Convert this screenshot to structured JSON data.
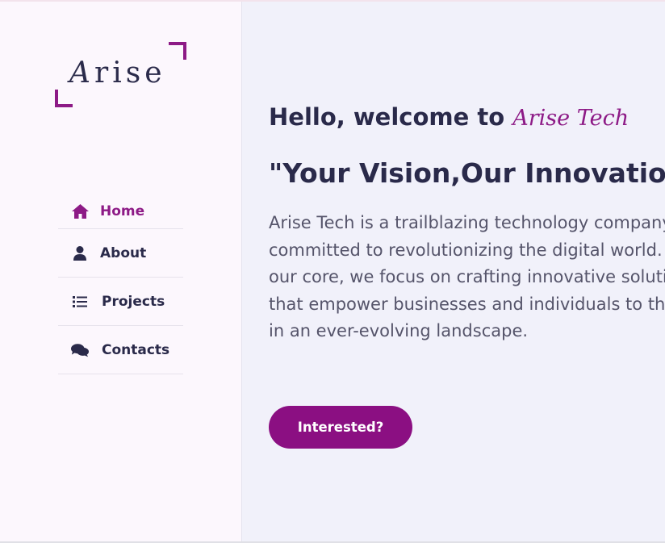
{
  "colors": {
    "accent": "#8d1a86",
    "button": "#8b0f82",
    "text_dark": "#2a2a4a",
    "text_body": "#55546a",
    "sidebar_bg": "#fcf7fd",
    "main_bg": "#f1f1fa"
  },
  "logo": {
    "first_letter": "A",
    "rest": "rise"
  },
  "nav": {
    "items": [
      {
        "label": "Home",
        "icon": "home-icon",
        "active": true
      },
      {
        "label": "About",
        "icon": "user-icon",
        "active": false
      },
      {
        "label": "Projects",
        "icon": "list-icon",
        "active": false
      },
      {
        "label": "Contacts",
        "icon": "comments-icon",
        "active": false
      }
    ]
  },
  "hero": {
    "welcome_prefix": "Hello, welcome to ",
    "brand": "Arise Tech",
    "tagline": "\"Your Vision,Our Innovation\"",
    "description_lines": [
      "Arise Tech is a trailblazing technology company",
      "committed to revolutionizing the digital world. At",
      "our core, we focus on crafting innovative solutions",
      "that empower businesses and individuals to thrive",
      "in an ever-evolving landscape."
    ],
    "cta_label": "Interested?"
  }
}
